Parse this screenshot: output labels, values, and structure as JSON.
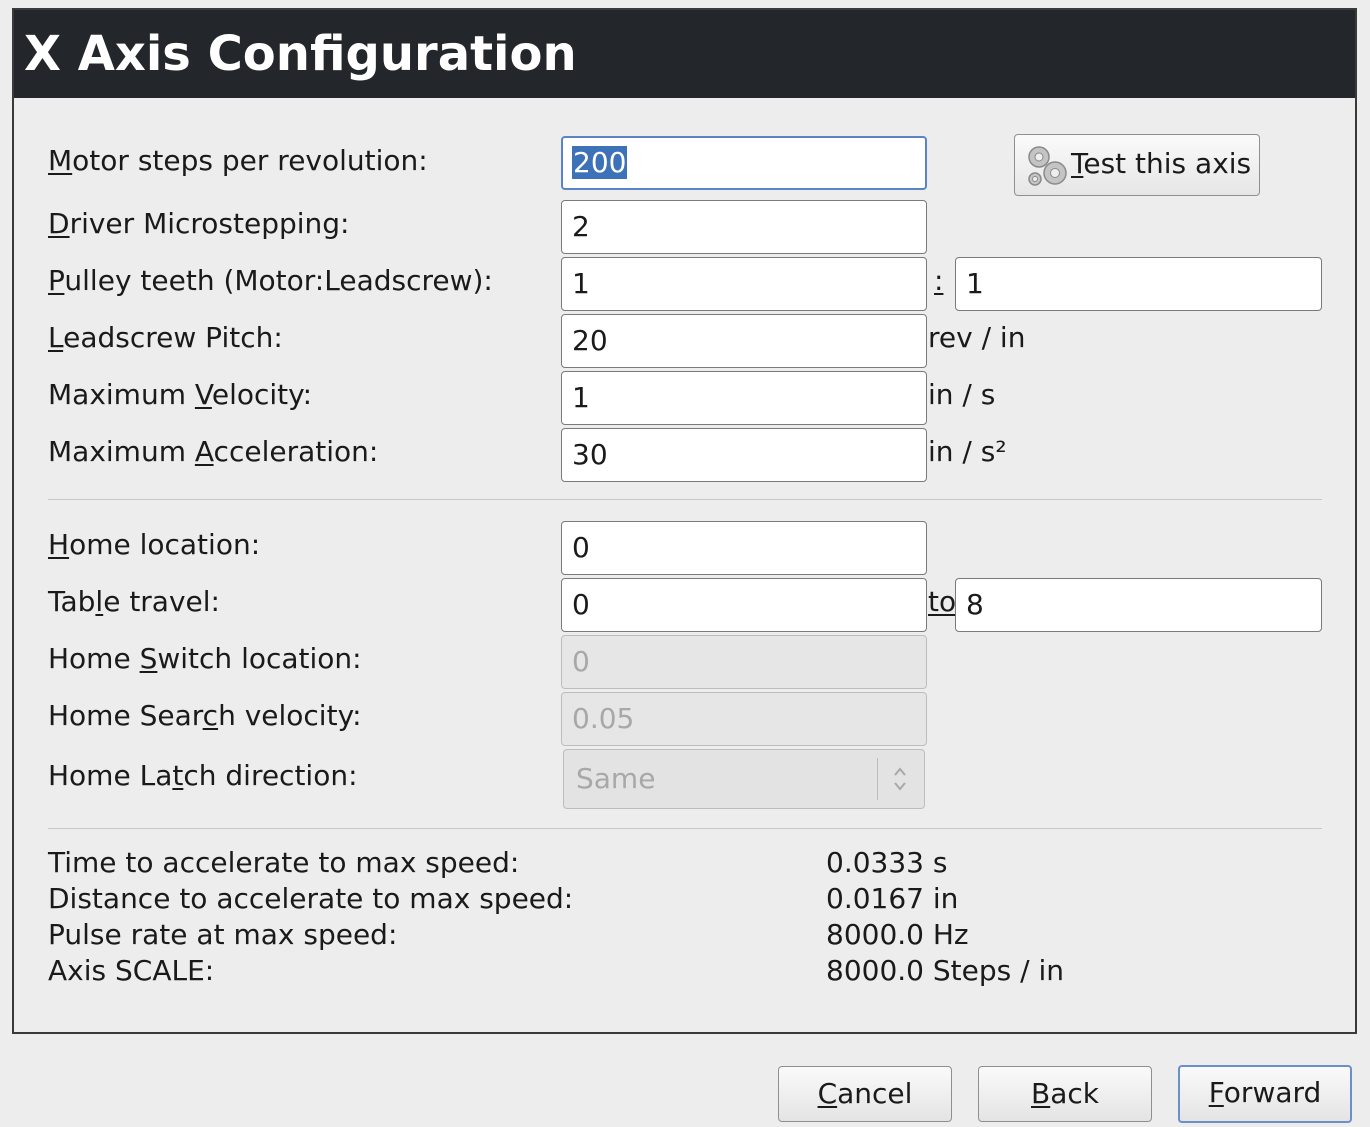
{
  "window": {
    "title": "X Axis Configuration"
  },
  "motor": {
    "steps_label": "Motor steps per revolution:",
    "steps_value": "200",
    "microstep_label": "Driver Microstepping:",
    "microstep_value": "2",
    "pulley_label": "Pulley teeth (Motor:Leadscrew):",
    "pulley_motor_value": "1",
    "pulley_sep": ":",
    "pulley_leadscrew_value": "1",
    "pitch_label": "Leadscrew Pitch:",
    "pitch_value": "20",
    "pitch_unit": "rev / in",
    "velocity_label": "Maximum Velocity:",
    "velocity_value": "1",
    "velocity_unit": "in / s",
    "accel_label": "Maximum Acceleration:",
    "accel_value": "30",
    "accel_unit": "in / s²"
  },
  "test_button": {
    "label": "Test this axis",
    "icon": "gears-icon"
  },
  "home": {
    "location_label": "Home location:",
    "location_value": "0",
    "travel_label": "Table travel:",
    "travel_min_value": "0",
    "travel_to": "to",
    "travel_max_value": "8",
    "switch_label": "Home Switch location:",
    "switch_value": "0",
    "search_label": "Home Search velocity:",
    "search_value": "0.05",
    "latch_label": "Home Latch direction:",
    "latch_value": "Same"
  },
  "info": {
    "time_label": "Time to accelerate to max speed:",
    "time_value": "0.0333 s",
    "distance_label": "Distance to accelerate to max speed:",
    "distance_value": "0.0167 in",
    "pulse_label": "Pulse rate at max speed:",
    "pulse_value": "8000.0 Hz",
    "scale_label": "Axis SCALE:",
    "scale_value": "8000.0 Steps / in"
  },
  "buttons": {
    "cancel": "Cancel",
    "back": "Back",
    "forward": "Forward"
  },
  "colors": {
    "titlebar": "#23272b",
    "focus": "#5b84c4",
    "selection": "#3d72b8"
  }
}
